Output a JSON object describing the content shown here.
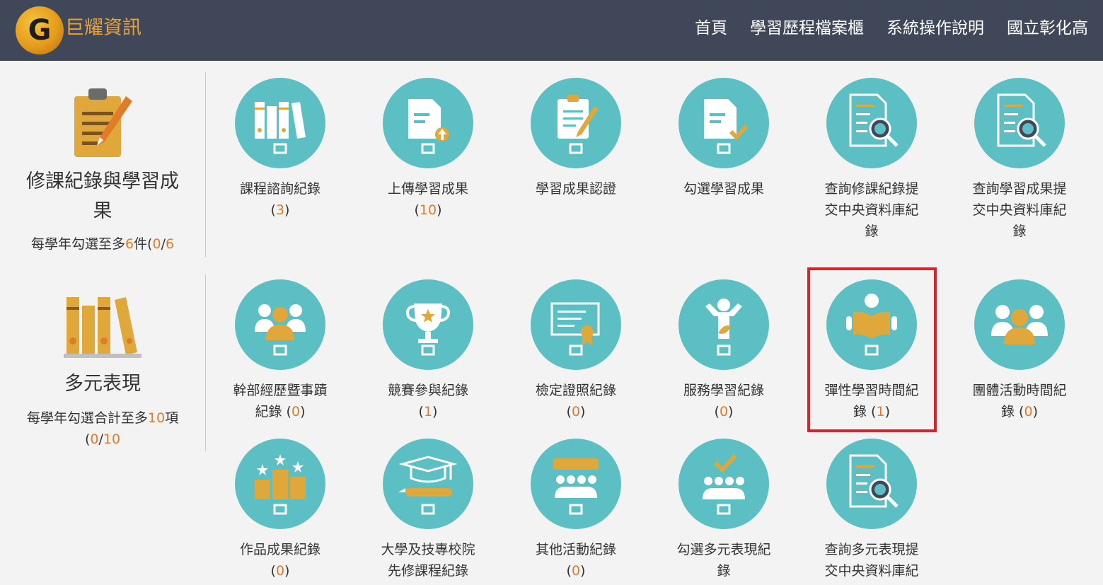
{
  "header": {
    "logo_glyph": "G",
    "brand": "巨耀資訊",
    "nav": [
      "首頁",
      "學習歷程檔案櫃",
      "系統操作說明",
      "國立彰化高"
    ]
  },
  "categories": {
    "course": {
      "title_1": "修課紀錄與學習成",
      "title_2": "果",
      "note_pre": "每學年勾選至多",
      "note_n1": "6",
      "note_mid": "件(",
      "note_n2": "0",
      "note_slash": "/",
      "note_n3": "6"
    },
    "diverse": {
      "title": "多元表現",
      "note_pre": "每學年勾選合計至多",
      "note_n1": "10",
      "note_mid": "項",
      "note_open": "(",
      "note_n2": "0",
      "note_slash": "/",
      "note_n3": "10"
    }
  },
  "tiles": {
    "course_consult": {
      "l1": "課程諮詢紀錄",
      "count": "3",
      "icon": "books-icon"
    },
    "upload_results": {
      "l1": "上傳學習成果",
      "count": "10",
      "icon": "document-upload-icon"
    },
    "verify_results": {
      "l1": "學習成果認證",
      "icon": "clipboard-pencil-icon"
    },
    "select_results": {
      "l1": "勾選學習成果",
      "icon": "document-check-icon"
    },
    "query_course_submit": {
      "l1": "查詢修課紀錄提",
      "l2": "交中央資料庫紀",
      "l3": "錄",
      "icon": "document-search-icon"
    },
    "query_results_submit": {
      "l1": "查詢學習成果提",
      "l2": "交中央資料庫紀",
      "l3": "錄",
      "icon": "document-search-icon"
    },
    "cadre": {
      "l1": "幹部經歷暨事蹟",
      "l2": "紀錄",
      "count": "0",
      "icon": "group-leader-icon"
    },
    "competition": {
      "l1": "競賽參與紀錄",
      "count": "1",
      "icon": "trophy-icon"
    },
    "certificate": {
      "l1": "檢定證照紀錄",
      "count": "0",
      "icon": "certificate-icon"
    },
    "service": {
      "l1": "服務學習紀錄",
      "count": "0",
      "icon": "service-person-icon"
    },
    "flexible": {
      "l1": "彈性學習時間紀",
      "l2": "錄",
      "count": "1",
      "icon": "reading-person-icon"
    },
    "group_activity": {
      "l1": "團體活動時間紀",
      "l2": "錄",
      "count": "0",
      "icon": "group-people-icon"
    },
    "works": {
      "l1": "作品成果紀錄",
      "count": "0",
      "icon": "podium-stars-icon"
    },
    "advanced_courses": {
      "l1": "大學及技專校院",
      "l2": "先修課程紀錄",
      "icon": "graduation-cap-icon"
    },
    "other_activities": {
      "l1": "其他活動紀錄",
      "count": "0",
      "icon": "audience-chat-icon"
    },
    "select_diverse": {
      "l1": "勾選多元表現紀",
      "l2": "錄",
      "icon": "audience-check-icon"
    },
    "query_diverse_submit": {
      "l1": "查詢多元表現提",
      "l2": "交中央資料庫紀",
      "icon": "document-search-icon"
    }
  },
  "colors": {
    "header_bg": "#3f4758",
    "circle": "#5bbfc3",
    "accent": "#e8a23c",
    "highlight": "#e07b2a",
    "selection": "#d9242a"
  }
}
